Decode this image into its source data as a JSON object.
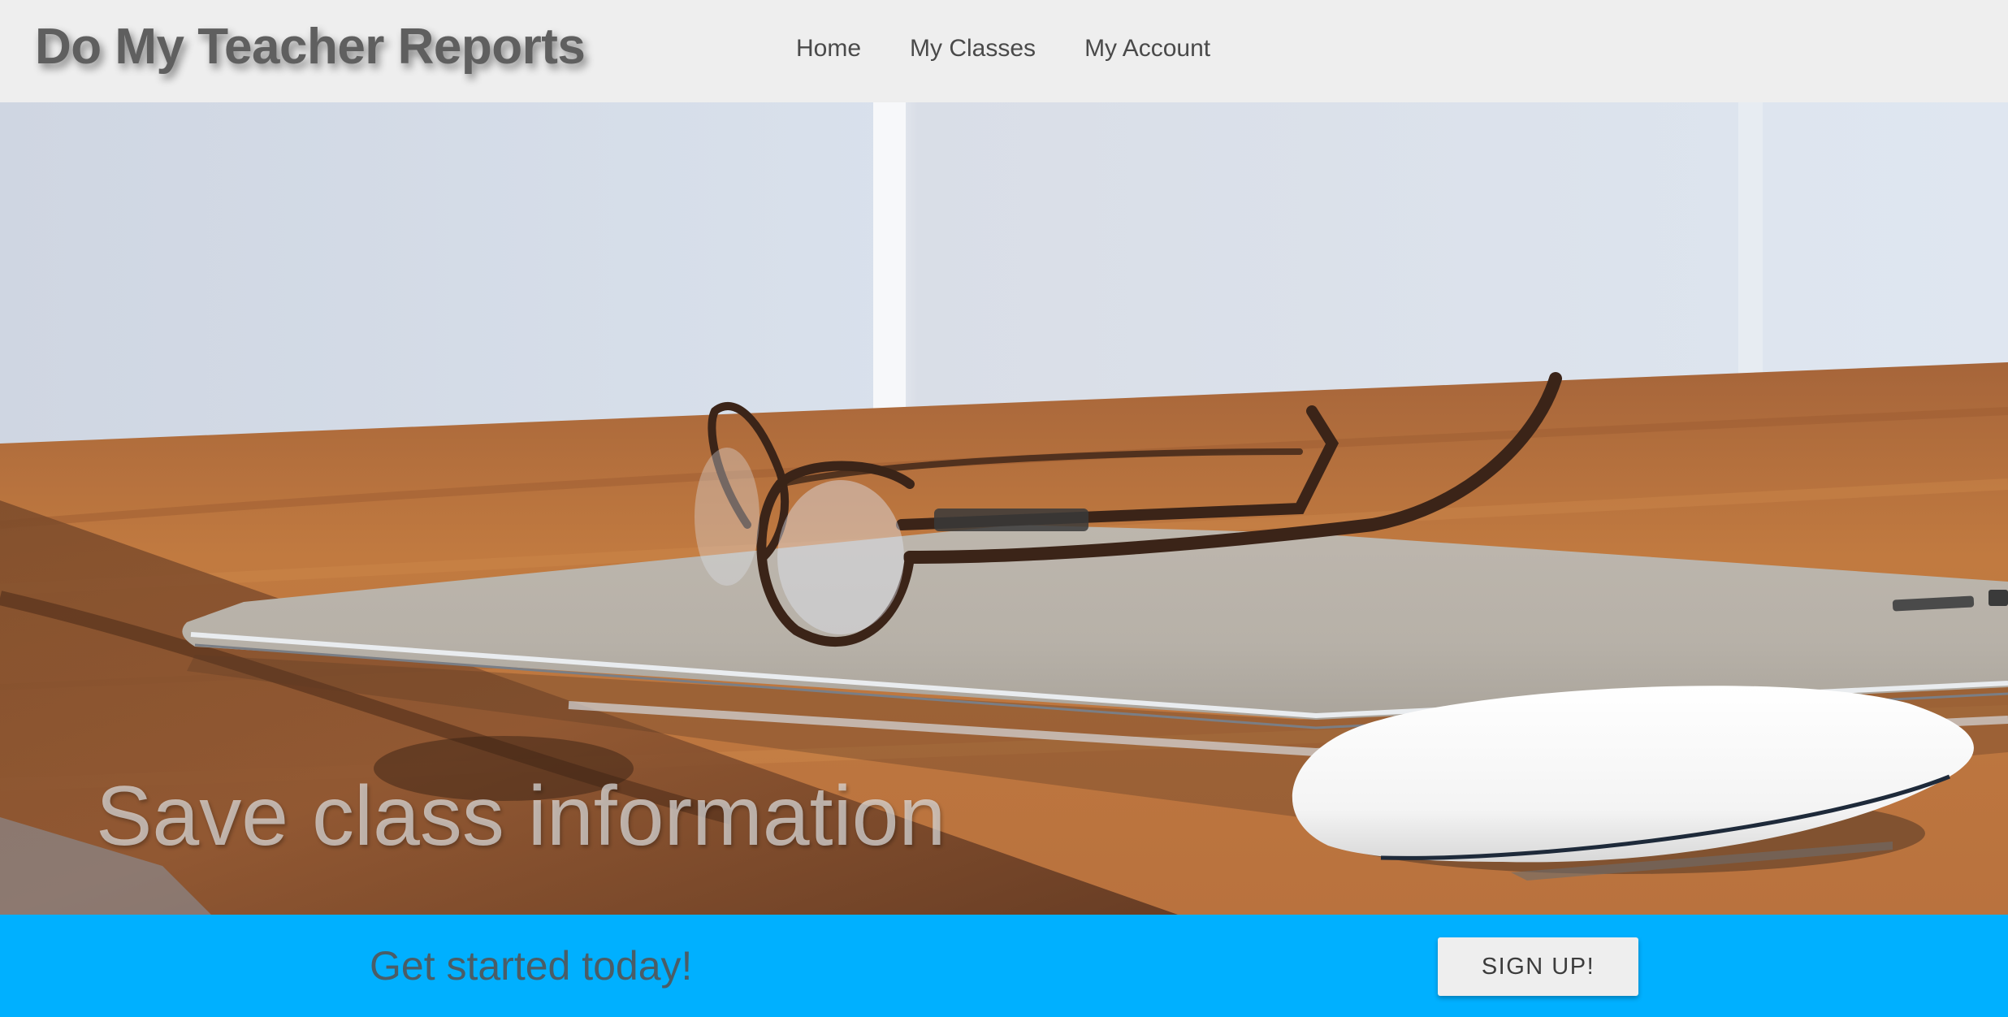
{
  "header": {
    "brand": "Do My Teacher Reports",
    "nav": [
      {
        "label": "Home"
      },
      {
        "label": "My Classes"
      },
      {
        "label": "My Account"
      }
    ]
  },
  "hero": {
    "caption": "Save class information",
    "image_subject": "glasses on a closed laptop with a mouse on a wooden desk"
  },
  "cta": {
    "text": "Get started today!",
    "button_label": "SIGN UP!"
  },
  "colors": {
    "header_bg": "#eeeeee",
    "cta_bar_bg": "#00b0ff",
    "button_bg": "#eeeeee",
    "brand_text": "#5f5f5f"
  }
}
